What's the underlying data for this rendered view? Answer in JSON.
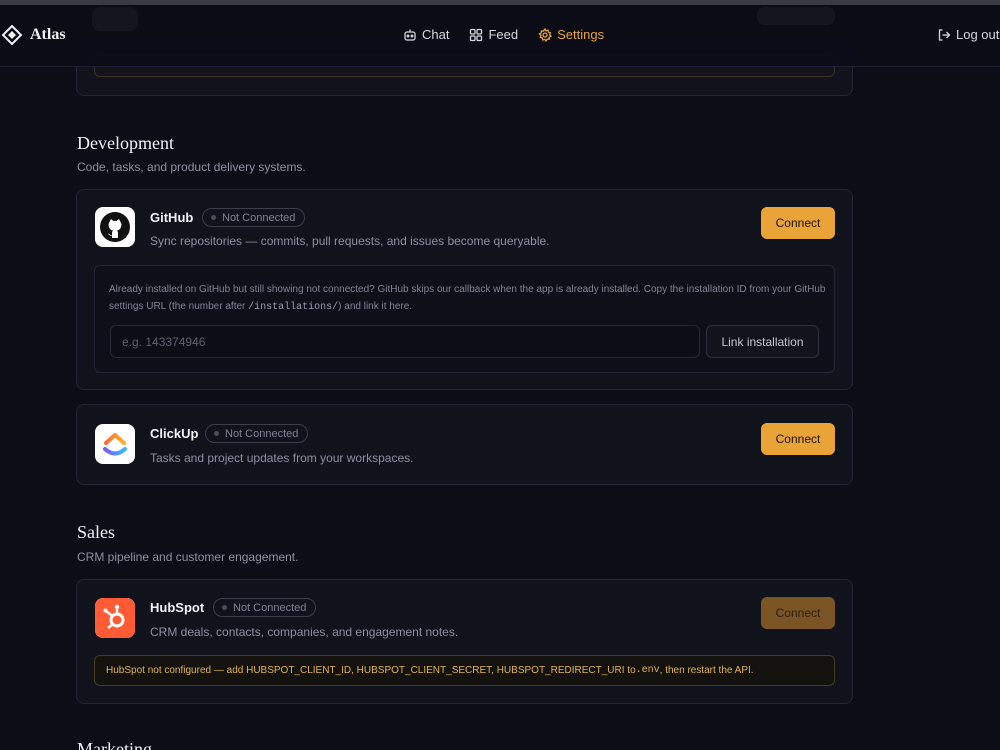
{
  "header": {
    "brand": "Atlas",
    "nav": [
      {
        "label": "Chat",
        "icon": "bot-icon"
      },
      {
        "label": "Feed",
        "icon": "grid-icon"
      },
      {
        "label": "Settings",
        "icon": "gear-icon",
        "active": true
      }
    ],
    "logout_label": "Log out"
  },
  "colors": {
    "accent": "#e9a336",
    "background": "#0b0d17",
    "card": "#10121c"
  },
  "sections": {
    "development": {
      "title": "Development",
      "subtitle": "Code, tasks, and product delivery systems."
    },
    "sales": {
      "title": "Sales",
      "subtitle": "CRM pipeline and customer engagement."
    },
    "marketing": {
      "title": "Marketing"
    }
  },
  "integrations": {
    "github": {
      "name": "GitHub",
      "status": "Not Connected",
      "description": "Sync repositories — commits, pull requests, and issues become queryable.",
      "connect_label": "Connect",
      "install_hint_part1": "Already installed on GitHub but still showing not connected? GitHub skips our callback when the app is already installed. Copy the installation ID from your GitHub settings URL (the number after ",
      "install_hint_code": "/installations/",
      "install_hint_part2": ") and link it here.",
      "install_placeholder": "e.g. 143374946",
      "link_label": "Link installation"
    },
    "clickup": {
      "name": "ClickUp",
      "status": "Not Connected",
      "description": "Tasks and project updates from your workspaces.",
      "connect_label": "Connect"
    },
    "hubspot": {
      "name": "HubSpot",
      "status": "Not Connected",
      "description": "CRM deals, contacts, companies, and engagement notes.",
      "connect_label": "Connect",
      "warning_part1": "HubSpot not configured — add HUBSPOT_CLIENT_ID, HUBSPOT_CLIENT_SECRET, HUBSPOT_REDIRECT_URI to ",
      "warning_code": ".env",
      "warning_part2": ", then restart the API."
    }
  }
}
